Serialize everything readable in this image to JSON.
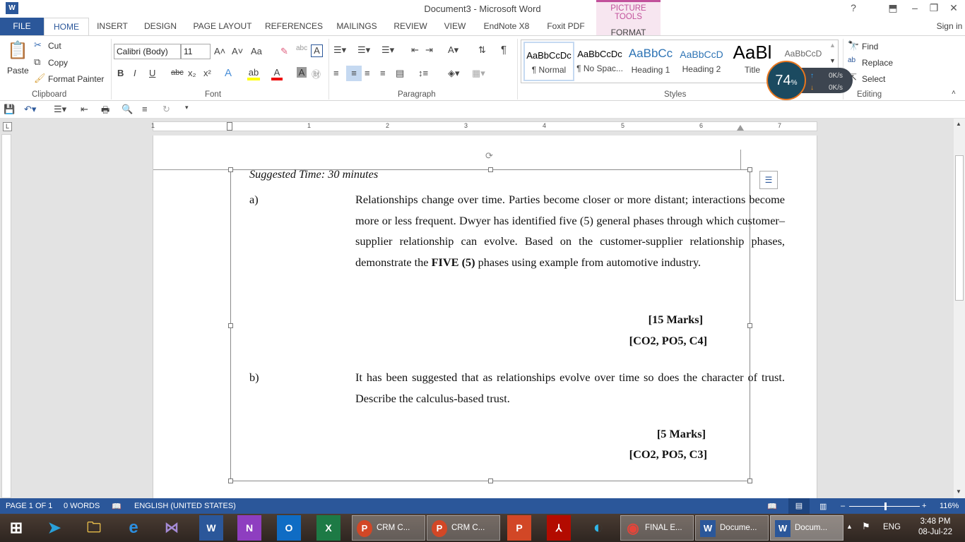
{
  "window": {
    "title": "Document3 - Microsoft Word",
    "app_icon": "W",
    "help": "?",
    "sign_in": "Sign in"
  },
  "contextual": {
    "group": "PICTURE TOOLS",
    "tab": "FORMAT"
  },
  "tabs": [
    "FILE",
    "HOME",
    "INSERT",
    "DESIGN",
    "PAGE LAYOUT",
    "REFERENCES",
    "MAILINGS",
    "REVIEW",
    "VIEW",
    "EndNote X8",
    "Foxit PDF"
  ],
  "clipboard": {
    "paste": "Paste",
    "cut": "Cut",
    "copy": "Copy",
    "format_painter": "Format Painter",
    "label": "Clipboard"
  },
  "font": {
    "name": "Calibri (Body)",
    "size": "11",
    "label": "Font",
    "bold": "B",
    "italic": "I",
    "underline": "U",
    "strike": "abc",
    "sub": "x₂",
    "sup": "x²",
    "case": "Aa"
  },
  "paragraph": {
    "label": "Paragraph",
    "pilcrow": "¶"
  },
  "styles": {
    "label": "Styles",
    "items": [
      {
        "preview": "AaBbCcDc",
        "name": "¶ Normal"
      },
      {
        "preview": "AaBbCcDc",
        "name": "¶ No Spac..."
      },
      {
        "preview": "AaBbCc",
        "name": "Heading 1"
      },
      {
        "preview": "AaBbCcD",
        "name": "Heading 2"
      },
      {
        "preview": "AaBl",
        "name": "Title"
      },
      {
        "preview": "AaBbCcD",
        "name": ""
      }
    ]
  },
  "editing": {
    "label": "Editing",
    "find": "Find",
    "replace": "Replace",
    "select": "Select"
  },
  "net_widget": {
    "percent": "74",
    "unit": "%",
    "up": "0K/s",
    "down": "0K/s"
  },
  "ruler": {
    "numbers": [
      "1",
      "1",
      "2",
      "3",
      "4",
      "5",
      "6",
      "7"
    ]
  },
  "document": {
    "suggested": "Suggested Time: 30 minutes",
    "a_label": "a)",
    "a_text_1": "Relationships change over time. Parties become closer or more distant; interactions become more or less frequent.  Dwyer has identified five (5) general phases through which customer–supplier relationship can evolve.  Based on the customer-supplier relationship phases, demonstrate the ",
    "a_bold": "FIVE (5)",
    "a_text_2": " phases using example from automotive industry.",
    "a_marks": "[15 Marks]",
    "a_co": "[CO2, PO5, C4]",
    "b_label": "b)",
    "b_text": "It has been suggested that as relationships evolve over time so does the character of trust. Describe the calculus-based trust.",
    "b_marks": "[5 Marks]",
    "b_co": "[CO2, PO5, C3]"
  },
  "status": {
    "page": "PAGE 1 OF 1",
    "words": "0 WORDS",
    "language": "ENGLISH (UNITED STATES)",
    "zoom": "116%",
    "zoom_level": 116
  },
  "taskbar": {
    "apps": [
      {
        "label": "CRM C..."
      },
      {
        "label": "CRM C..."
      },
      {
        "label": "FINAL E..."
      },
      {
        "label": "Docume..."
      },
      {
        "label": "Docum..."
      }
    ],
    "lang": "ENG",
    "time": "3:48 PM",
    "date": "08-Jul-22"
  },
  "colors": {
    "accent": "#2b579a",
    "picture_tools": "#c2519b"
  }
}
